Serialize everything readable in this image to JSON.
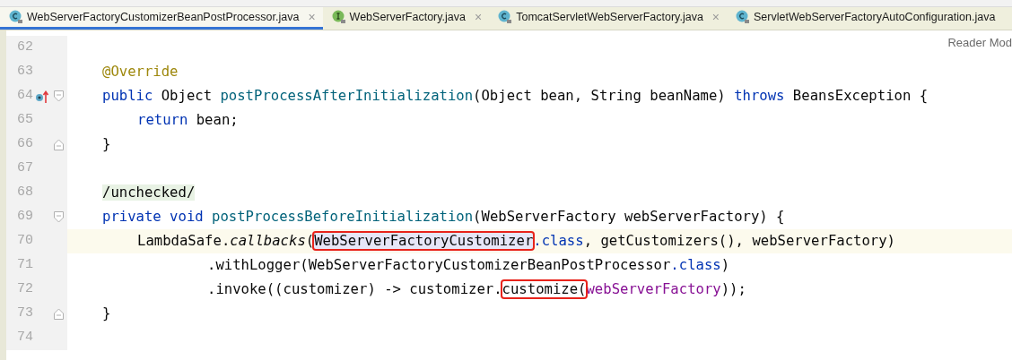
{
  "tabs": [
    {
      "label": "WebServerFactoryCustomizerBeanPostProcessor.java",
      "kind": "class",
      "selected": true,
      "close": "×"
    },
    {
      "label": "WebServerFactory.java",
      "kind": "interface",
      "selected": false,
      "close": "×"
    },
    {
      "label": "TomcatServletWebServerFactory.java",
      "kind": "class",
      "selected": false,
      "close": "×"
    },
    {
      "label": "ServletWebServerFactoryAutoConfiguration.java",
      "kind": "class",
      "selected": false
    }
  ],
  "reader_mode": "Reader Mod",
  "lines": [
    {
      "number": "62",
      "current": false
    },
    {
      "number": "63",
      "current": false,
      "kind": "member",
      "tokens": [
        {
          "text": "@Override",
          "kind": "annotation"
        }
      ]
    },
    {
      "number": "64",
      "current": false,
      "override_marker": true,
      "fold_start": true,
      "kind": "member",
      "tokens": [
        {
          "text": "public ",
          "kind": "keyword"
        },
        {
          "text": "Object ",
          "kind": "plain"
        },
        {
          "text": "postProcessAfterInitialization",
          "kind": "method"
        },
        {
          "text": "(Object bean, String beanName) ",
          "kind": "plain"
        },
        {
          "text": "throws ",
          "kind": "keyword"
        },
        {
          "text": "BeansException {",
          "kind": "plain"
        }
      ]
    },
    {
      "number": "65",
      "current": false,
      "kind": "statement",
      "tokens": [
        {
          "text": "return ",
          "kind": "keyword"
        },
        {
          "text": "bean;",
          "kind": "plain"
        }
      ]
    },
    {
      "number": "66",
      "current": false,
      "fold_end": true,
      "kind": "member",
      "tokens": [
        {
          "text": "}",
          "kind": "plain"
        }
      ]
    },
    {
      "number": "67",
      "current": false
    },
    {
      "number": "68",
      "current": false,
      "kind": "member",
      "tokens": [
        {
          "text": "/unchecked/",
          "kind": "folded"
        }
      ]
    },
    {
      "number": "69",
      "current": false,
      "fold_start": true,
      "kind": "member",
      "tokens": [
        {
          "text": "private void ",
          "kind": "keyword"
        },
        {
          "text": "postProcessBeforeInitialization",
          "kind": "method"
        },
        {
          "text": "(WebServerFactory webServerFactory) {",
          "kind": "plain"
        }
      ]
    },
    {
      "number": "70",
      "current": true,
      "kind": "statement",
      "tokens": [
        {
          "text": "LambdaSafe.",
          "kind": "plain"
        },
        {
          "text": "callbacks",
          "kind": "italic"
        },
        {
          "text": "(",
          "kind": "plain"
        },
        {
          "text": "WebServerFactoryCustomizer",
          "kind": "usage",
          "boxed": true
        },
        {
          "text": ".class",
          "kind": "keyword"
        },
        {
          "text": ", getCustomizers(), webServerFactory)",
          "kind": "plain"
        }
      ]
    },
    {
      "number": "71",
      "current": false,
      "kind": "continuation",
      "tokens": [
        {
          "text": ".withLogger(WebServerFactoryCustomizerBeanPostProcessor",
          "kind": "plain"
        },
        {
          "text": ".class",
          "kind": "keyword"
        },
        {
          "text": ")",
          "kind": "plain"
        }
      ]
    },
    {
      "number": "72",
      "current": false,
      "kind": "continuation",
      "tokens": [
        {
          "text": ".invoke((customizer) -> customizer.",
          "kind": "plain"
        },
        {
          "text": "customize(",
          "kind": "plain",
          "boxed": true
        },
        {
          "text": "webServerFactory",
          "kind": "param"
        },
        {
          "text": "));",
          "kind": "plain"
        }
      ]
    },
    {
      "number": "73",
      "current": false,
      "fold_end": true,
      "kind": "member",
      "tokens": [
        {
          "text": "}",
          "kind": "plain"
        }
      ]
    },
    {
      "number": "74",
      "current": false
    }
  ]
}
